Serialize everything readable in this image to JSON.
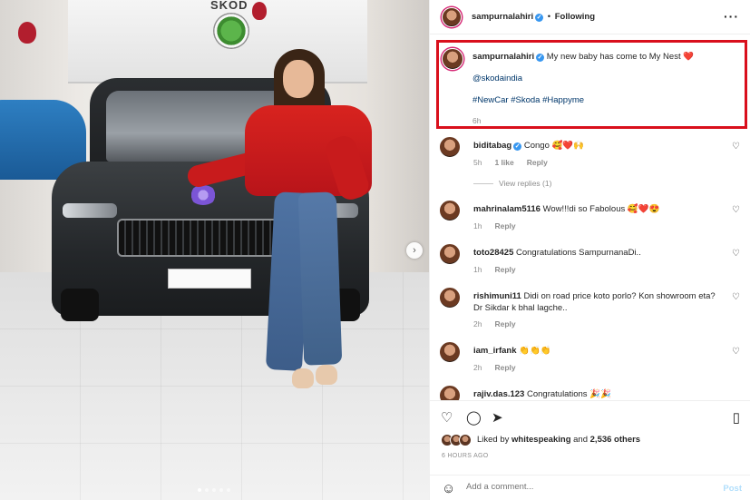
{
  "photo": {
    "brand_text": "SKOD",
    "carousel_dots": 5,
    "active_dot": 0
  },
  "post": {
    "author": "sampurnalahiri",
    "follow_sep": "•",
    "follow_label": "Following",
    "more_icon": "more-horizontal-icon"
  },
  "caption": {
    "author": "sampurnalahiri",
    "text": "My new baby has come to My Nest ❤️",
    "mention": "@skodaindia",
    "hashtags": "#NewCar #Skoda #Happyme",
    "time": "6h"
  },
  "comments": [
    {
      "user": "biditabag",
      "verified": true,
      "text": "Congo 🥰❤️🙌",
      "time": "5h",
      "likes": "1 like",
      "reply": "Reply"
    },
    {
      "user": "mahrinalam5116",
      "verified": false,
      "text": "Wow!!!di so Fabolous 🥰❤️😍",
      "time": "1h",
      "reply": "Reply"
    },
    {
      "user": "toto28425",
      "verified": false,
      "text": "Congratulations SampurnanaDi..",
      "time": "1h",
      "reply": "Reply"
    },
    {
      "user": "rishimuni11",
      "verified": false,
      "text": "Didi on road price koto porlo? Kon showroom eta? Dr Sikdar k bhal lagche..",
      "time": "2h",
      "reply": "Reply"
    },
    {
      "user": "iam_irfank",
      "verified": false,
      "text": "👏👏👏",
      "time": "2h",
      "reply": "Reply"
    },
    {
      "user": "rajiv.das.123",
      "verified": false,
      "text": "Congratulations 🎉🎉",
      "time": "",
      "reply": ""
    }
  ],
  "view_replies": "View replies (1)",
  "actions": {
    "liked_prefix": "Liked by",
    "liked_user": "whitespeaking",
    "liked_and": "and",
    "liked_count": "2,536 others",
    "posted_ago": "6 HOURS AGO"
  },
  "add_comment": {
    "placeholder": "Add a comment...",
    "post_label": "Post"
  },
  "colors": {
    "highlight_border": "#d90f1c",
    "link": "#00376b",
    "verified": "#3897f0",
    "post_button": "#b2dffc"
  }
}
